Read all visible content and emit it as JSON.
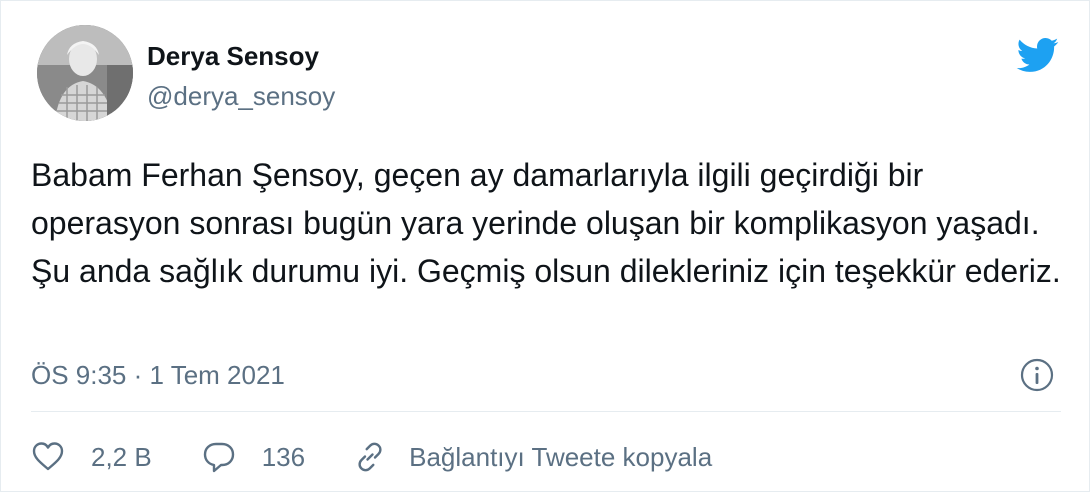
{
  "author": {
    "display_name": "Derya Sensoy",
    "handle": "@derya_sensoy",
    "avatar_icon": "profile-photo"
  },
  "brand": {
    "logo_icon": "twitter-bird-icon",
    "color": "#1da1f2"
  },
  "tweet": {
    "text": "Babam Ferhan Şensoy, geçen ay damarlarıyla ilgili geçirdiği bir operasyon sonrası bugün yara yerinde oluşan bir komplikasyon yaşadı. Şu anda sağlık durumu iyi. Geçmiş olsun dilekleriniz için teşekkür ederiz.",
    "timestamp": "ÖS 9:35 · 1 Tem 2021"
  },
  "actions": {
    "like_count": "2,2 B",
    "reply_count": "136",
    "copy_link_label": "Bağlantıyı Tweete kopyala"
  },
  "colors": {
    "text_primary": "#0f1419",
    "text_secondary": "#5b7083",
    "divider": "#e6ecf0"
  }
}
